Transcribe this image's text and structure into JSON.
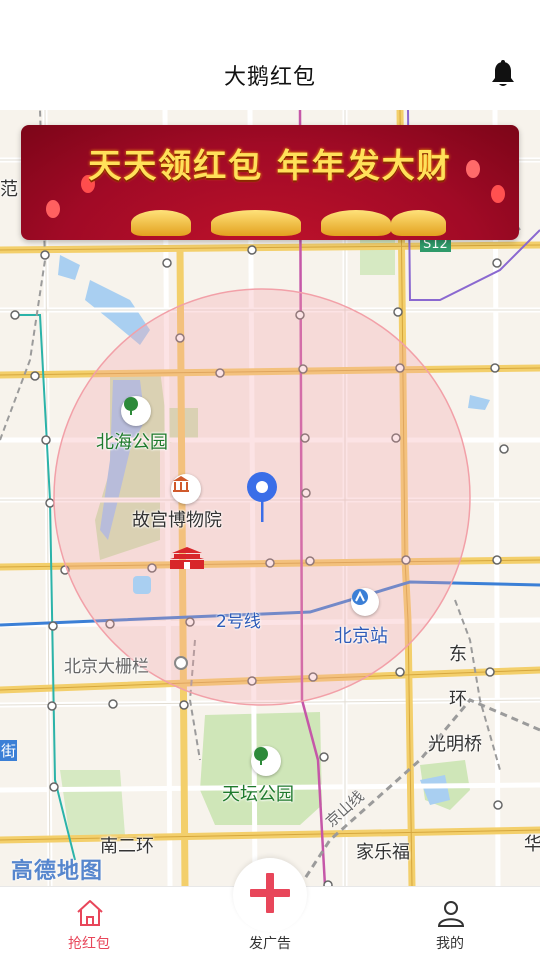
{
  "header": {
    "title": "大鹅红包"
  },
  "banner": {
    "text": "天天领红包   年年发大财"
  },
  "map": {
    "labels": {
      "beihai_park": "北海公园",
      "palace_museum": "故宫博物院",
      "line2": "2号线",
      "beijing_station": "北京站",
      "dashilan": "北京大栅栏",
      "dong": "东",
      "huan": "环",
      "guangmingqiao": "光明桥",
      "temple_of_heaven": "天坛公园",
      "nan_er_huan": "南二环",
      "jia_le_fu": "家乐福",
      "jingshan_line": "京山线",
      "s12": "S12",
      "hua": "华",
      "fan": "范",
      "jie": "街"
    },
    "watermark": "高德地图"
  },
  "tabs": [
    {
      "label": "抢红包",
      "active": true
    },
    {
      "label": "发广告",
      "active": false
    },
    {
      "label": "我的",
      "active": false
    }
  ],
  "colors": {
    "accent": "#e8465a",
    "circle_fill": "#f7c6c6",
    "pin": "#3a6ee8"
  }
}
